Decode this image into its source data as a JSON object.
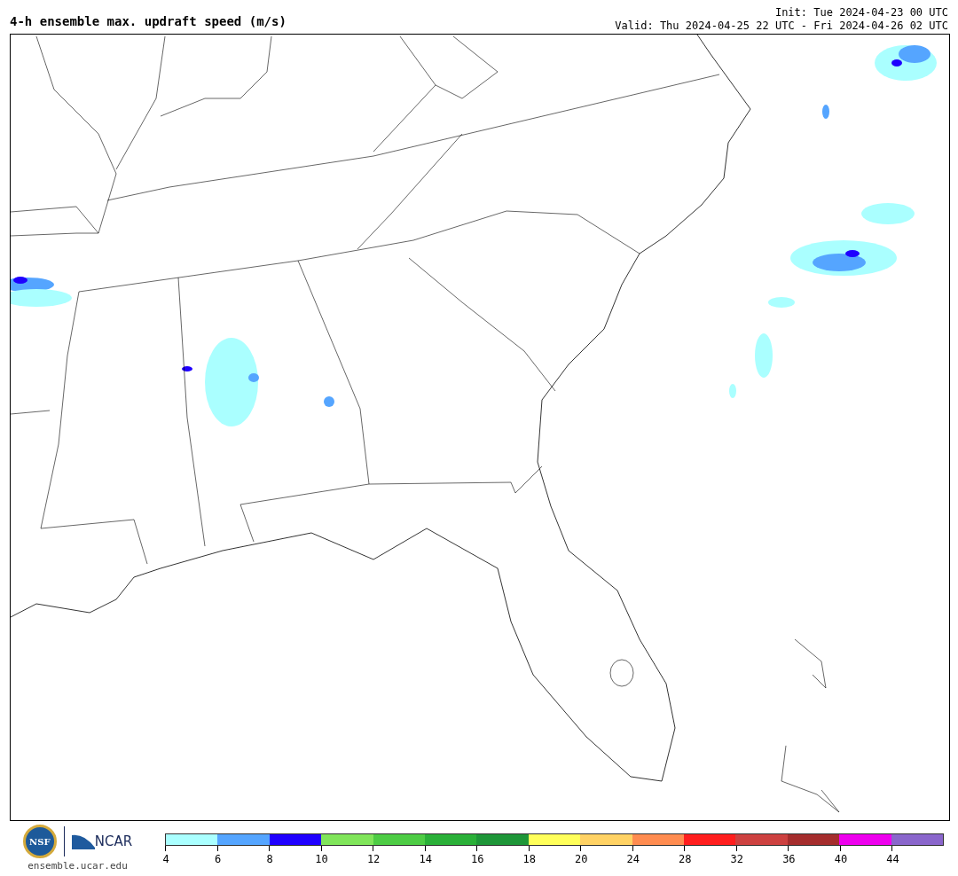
{
  "title": "4-h ensemble max. updraft speed (m/s)",
  "init": "Init: Tue 2024-04-23 00 UTC",
  "valid": "Valid: Thu 2024-04-25 22 UTC - Fri 2024-04-26 02 UTC",
  "logos": {
    "nsf": "NSF",
    "ncar": "NCAR",
    "url": "ensemble.ucar.edu"
  },
  "legend": [
    {
      "label": "4",
      "color": "#aaffff"
    },
    {
      "label": "6",
      "color": "#55a5ff"
    },
    {
      "label": "8",
      "color": "#1f00ff"
    },
    {
      "label": "10",
      "color": "#80e55a"
    },
    {
      "label": "12",
      "color": "#4dcc44"
    },
    {
      "label": "14",
      "color": "#2ab038"
    },
    {
      "label": "16",
      "color": "#1e9638"
    },
    {
      "label": "18",
      "color": "#ffff5a"
    },
    {
      "label": "20",
      "color": "#ffd264"
    },
    {
      "label": "24",
      "color": "#ff8c50"
    },
    {
      "label": "28",
      "color": "#ff1e1e"
    },
    {
      "label": "32",
      "color": "#cd4140"
    },
    {
      "label": "36",
      "color": "#a52d2d"
    },
    {
      "label": "40",
      "color": "#ee00ee"
    },
    {
      "label": "44",
      "color": "#8a66cc"
    }
  ]
}
